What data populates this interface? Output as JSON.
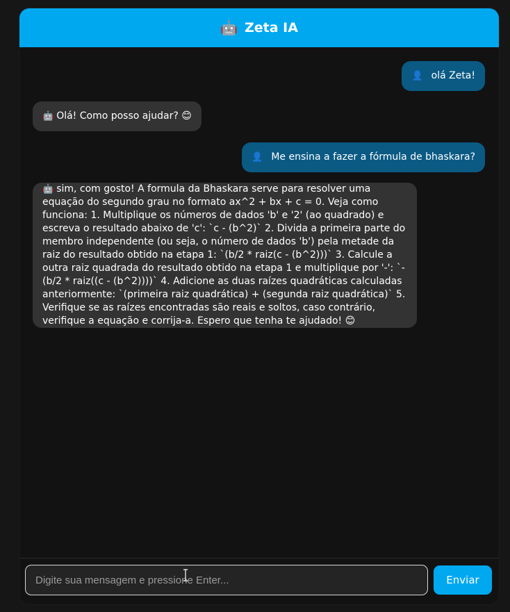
{
  "header": {
    "icon": "🤖",
    "icon_name": "robot-icon",
    "title": "Zeta IA",
    "color": "#00a8f0"
  },
  "messages": [
    {
      "role": "user",
      "icon": "👤",
      "icon_name": "user-avatar-icon",
      "text": "olá Zeta!"
    },
    {
      "role": "bot",
      "icon": "🤖",
      "icon_name": "robot-icon",
      "text": "Olá! Como posso ajudar? 😊"
    },
    {
      "role": "user",
      "icon": "👤",
      "icon_name": "user-avatar-icon",
      "text": "Me ensina a fazer a fórmula de bhaskara?"
    },
    {
      "role": "bot",
      "icon": "🤖",
      "icon_name": "robot-icon",
      "text": "sim, com gosto! A formula da Bhaskara serve para resolver uma equação do segundo grau no formato ax^2 + bx + c = 0. Veja como funciona: 1. Multiplique os números de dados 'b' e '2' (ao quadrado) e escreva o resultado abaixo de 'c': `c - (b^2)` 2. Divida a primeira parte do membro independente (ou seja, o número de dados 'b') pela metade da raiz do resultado obtido na etapa 1: `(b/2 * raiz(c - (b^2)))` 3. Calcule a outra raiz quadrada do resultado obtido na etapa 1 e multiplique por '-': `-(b/2 * raiz((c - (b^2))))` 4. Adicione as duas raízes quadráticas calculadas anteriormente: `(primeira raiz quadrática) + (segunda raiz quadrática)` 5. Verifique se as raízes encontradas são reais e soltos, caso contrário, verifique a equação e corrija-a. Espero que tenha te ajudado! 😊"
    }
  ],
  "composer": {
    "placeholder": "Digite sua mensagem e pressione Enter...",
    "value": "",
    "send_label": "Enviar"
  },
  "colors": {
    "accent": "#00a8f0",
    "user_bubble": "#0a5a84",
    "bot_bubble": "#333333",
    "background": "#121212"
  }
}
